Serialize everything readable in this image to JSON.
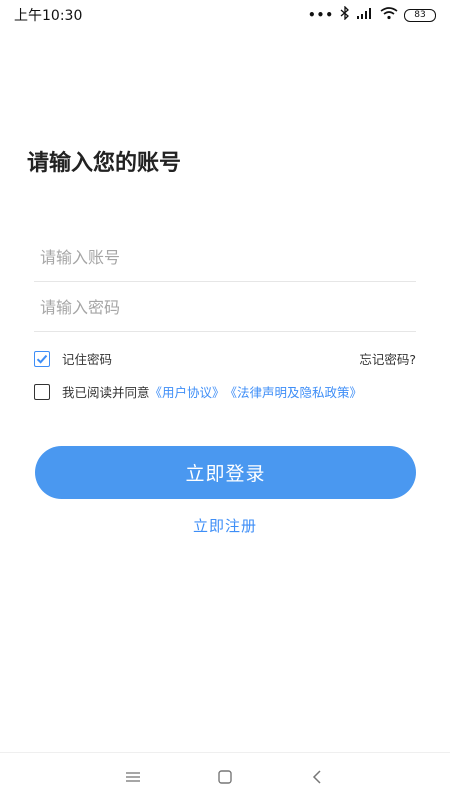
{
  "status_bar": {
    "time": "上午10:30",
    "dots": "•••",
    "battery": "83"
  },
  "login": {
    "title": "请输入您的账号",
    "account_placeholder": "请输入账号",
    "password_placeholder": "请输入密码",
    "remember_label": "记住密码",
    "remember_checked": true,
    "forgot_label": "忘记密码?",
    "agree_prefix": "我已阅读并同意",
    "user_agreement": "《用户协议》",
    "legal_policy": "《法律声明及隐私政策》",
    "agree_checked": false,
    "login_button": "立即登录",
    "register_link": "立即注册"
  },
  "colors": {
    "accent": "#4a98f0",
    "link": "#3e8ef7"
  },
  "nav_icons": [
    "menu-icon",
    "home-square-icon",
    "back-icon"
  ]
}
